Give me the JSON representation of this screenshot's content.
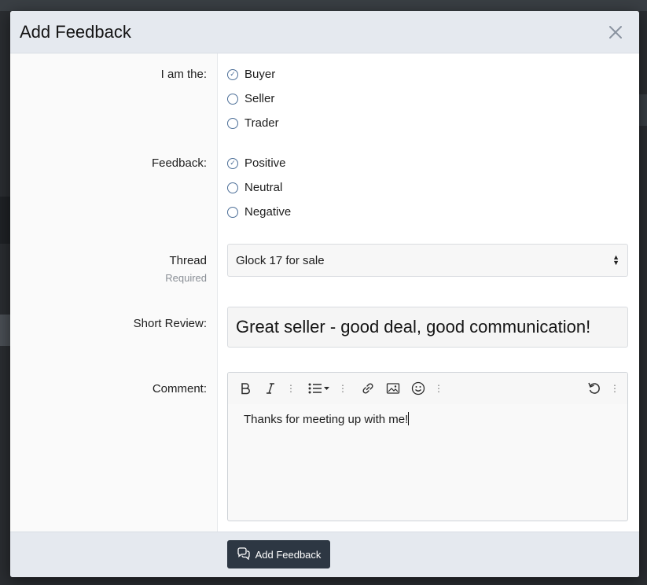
{
  "modal": {
    "title": "Add Feedback",
    "close_icon": "close-icon"
  },
  "role": {
    "label": "I am the:",
    "options": [
      {
        "label": "Buyer",
        "selected": true
      },
      {
        "label": "Seller",
        "selected": false
      },
      {
        "label": "Trader",
        "selected": false
      }
    ]
  },
  "feedback": {
    "label": "Feedback:",
    "options": [
      {
        "label": "Positive",
        "selected": true
      },
      {
        "label": "Neutral",
        "selected": false
      },
      {
        "label": "Negative",
        "selected": false
      }
    ]
  },
  "thread": {
    "label": "Thread",
    "hint": "Required",
    "selected": "Glock 17 for sale"
  },
  "short_review": {
    "label": "Short Review:",
    "value": "Great seller - good deal, good communication!"
  },
  "comment": {
    "label": "Comment:",
    "value": "Thanks for meeting up with me!",
    "toolbar": [
      "bold-icon",
      "italic-icon",
      "more-icon",
      "list-icon",
      "more-icon",
      "link-icon",
      "image-icon",
      "smiley-icon",
      "more-icon",
      "undo-icon",
      "more-icon"
    ]
  },
  "footer": {
    "submit_label": "Add Feedback",
    "submit_icon": "comments-icon"
  },
  "colors": {
    "header_bg": "#e5e9ef",
    "button_bg": "#2d3743",
    "radio_accent": "#4d6f98"
  }
}
